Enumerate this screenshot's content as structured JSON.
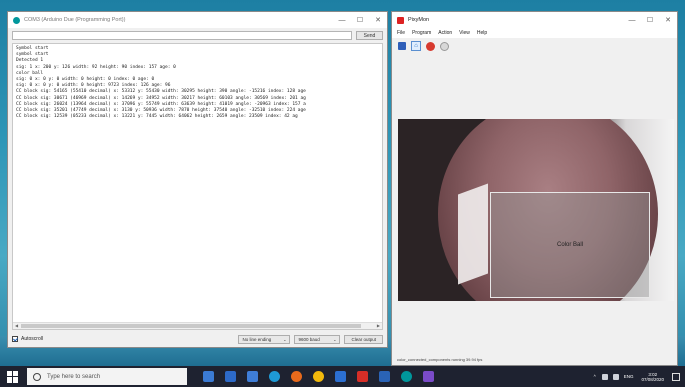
{
  "serial": {
    "title": "COM3 (Arduino Due (Programming Port))",
    "send_label": "Send",
    "input_value": "",
    "lines": [
      "Symbol start",
      "symbol start",
      "Detected 1",
      "sig: 1 x: 200 y: 126 width: 92 height: 90 index: 157 age: 0",
      "color ball",
      "sig: 0 x: 0 y: 0 width: 0 height: 0 index: 0 age: 0",
      "sig: 0 x: 0 y: 0 width: 0 height: 9723 index: 126 age: 96",
      "CC block sig: 54165 (55410 decimal) x: 53312 y: 55430 width: 30295 height: 390 angle: -15216 index: 128 age",
      "CC block sig: 30671 (46969 decimal) x: 14269 y: 34952 width: 30217 height: 60103 angle: 30569 index: 201 ag",
      "CC block sig: 26024 (13964 decimal) x: 37096 y: 55749 width: 63639 height: 41019 angle: -20963 index: 157 a",
      "CC block sig: 35201 (47749 decimal) x: 3130 y: 50936 width: 7870 height: 37540 angle: -32510 index: 224 age",
      "CC block sig: 12539 (05233 decimal) x: 13221 y: 7445 width: 64062 height: 2659 angle: 23509 index: 42 ag"
    ],
    "autoscroll_label": "Autoscroll",
    "line_ending": "No line ending",
    "baud": "9600 baud",
    "clear_label": "Clear output"
  },
  "pixy": {
    "title": "PixyMon",
    "menu": [
      "File",
      "Program",
      "Action",
      "View",
      "Help"
    ],
    "box_label": "Color Ball",
    "status": "color_connected_components running 39.94 fps"
  },
  "taskbar": {
    "search_placeholder": "Type here to search",
    "time": "3:02",
    "date": "07/08/2020",
    "lang": "ENG"
  },
  "window_controls": {
    "min": "—",
    "max": "☐",
    "close": "✕"
  },
  "colors": {
    "arduino": "#00979c",
    "taskbar": "#1e2230"
  }
}
